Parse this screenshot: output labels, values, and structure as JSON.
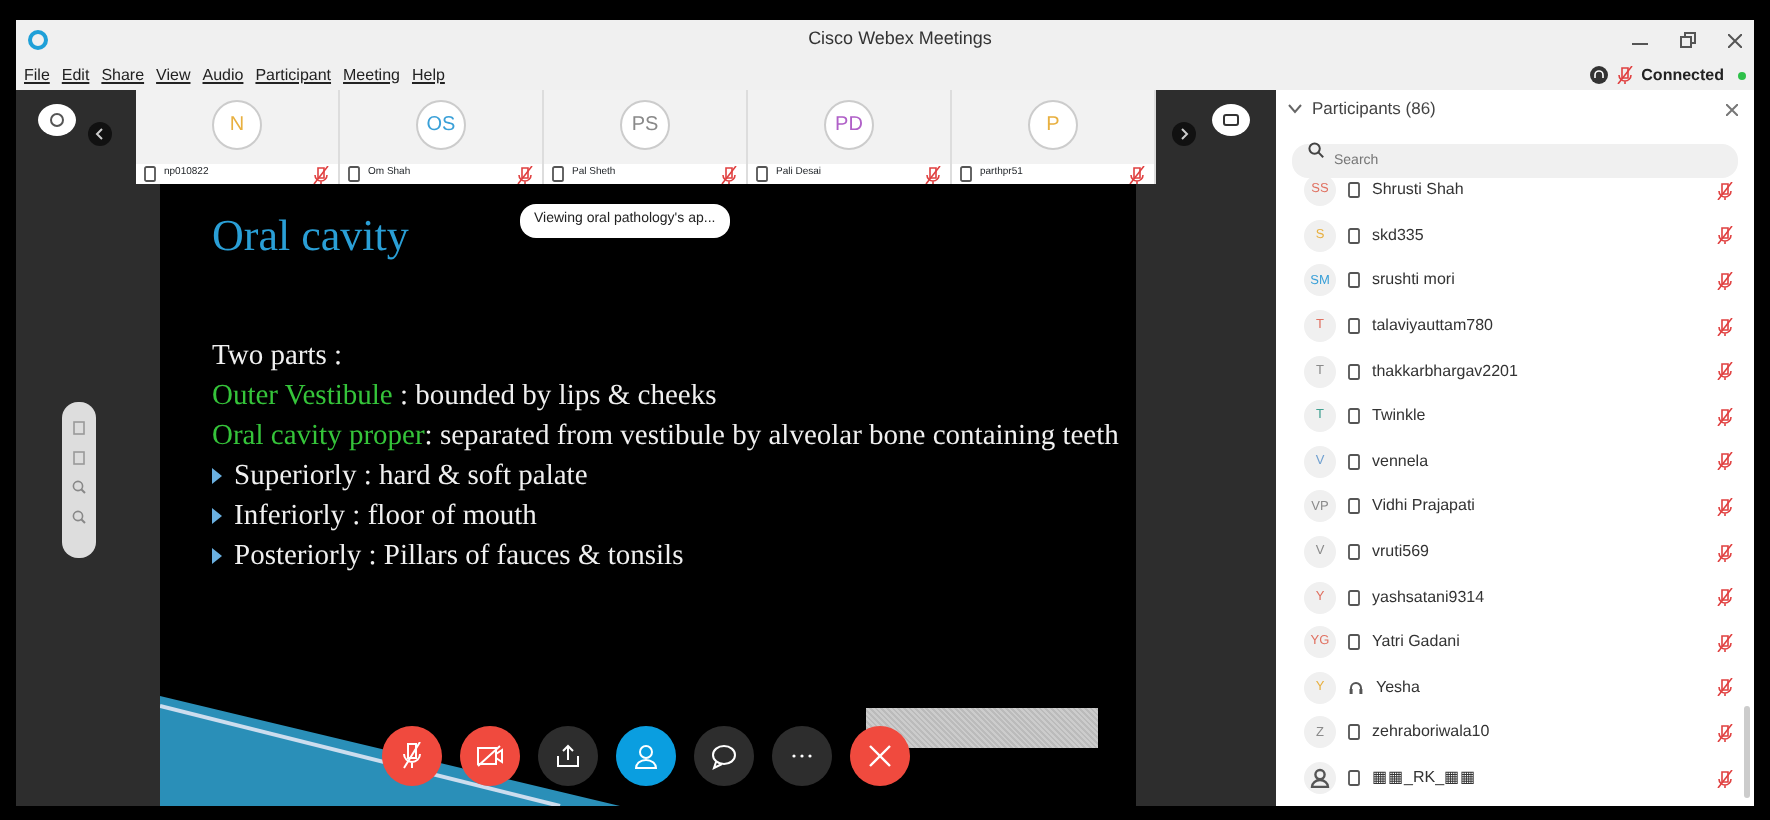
{
  "window": {
    "title": "Cisco Webex Meetings"
  },
  "menu": [
    "File",
    "Edit",
    "Share",
    "View",
    "Audio",
    "Participant",
    "Meeting",
    "Help"
  ],
  "status": {
    "text": "Connected",
    "connected": true
  },
  "thumbnails": [
    {
      "initials": "N",
      "name": "np010822",
      "color": "#e8b040"
    },
    {
      "initials": "OS",
      "name": "Om Shah",
      "color": "#3aa0d8"
    },
    {
      "initials": "PS",
      "name": "Pal Sheth",
      "color": "#8a8a8a"
    },
    {
      "initials": "PD",
      "name": "Pali Desai",
      "color": "#b060c8"
    },
    {
      "initials": "P",
      "name": "parthpr51",
      "color": "#e8b040"
    }
  ],
  "viewing_tag": "Viewing oral pathology's ap...",
  "slide": {
    "title": "Oral cavity",
    "lead": "Two parts :",
    "definitions": [
      {
        "term": "Outer Vestibule",
        "text": " : bounded by lips & cheeks"
      },
      {
        "term": "Oral cavity proper",
        "text": ": separated from vestibule by alveolar bone containing teeth"
      }
    ],
    "bullets": [
      "Superiorly : hard & soft palate",
      "Inferiorly : floor of  mouth",
      "Posteriorly  : Pillars of fauces & tonsils"
    ]
  },
  "controls": [
    {
      "kind": "mute",
      "active": false
    },
    {
      "kind": "video",
      "active": false
    },
    {
      "kind": "share",
      "active": false
    },
    {
      "kind": "participants",
      "active": true
    },
    {
      "kind": "chat",
      "active": false
    },
    {
      "kind": "more",
      "active": false
    },
    {
      "kind": "end",
      "active": false
    }
  ],
  "participants": {
    "title": "Participants (86)",
    "search": {
      "placeholder": "Search"
    },
    "items": [
      {
        "initials": "SS",
        "name": "Shrusti Shah",
        "kind": "phone",
        "color": "#e07060"
      },
      {
        "initials": "S",
        "name": "skd335",
        "kind": "phone",
        "color": "#e8b040"
      },
      {
        "initials": "SM",
        "name": "srushti mori",
        "kind": "phone",
        "color": "#3aa0d8"
      },
      {
        "initials": "T",
        "name": "talaviyauttam780",
        "kind": "phone",
        "color": "#e07060"
      },
      {
        "initials": "T",
        "name": "thakkarbhargav2201",
        "kind": "phone",
        "color": "#8a8a8a"
      },
      {
        "initials": "T",
        "name": "Twinkle",
        "kind": "phone",
        "color": "#40a090"
      },
      {
        "initials": "V",
        "name": "vennela",
        "kind": "phone",
        "color": "#70a0d0"
      },
      {
        "initials": "VP",
        "name": "Vidhi Prajapati",
        "kind": "phone",
        "color": "#8a8a8a"
      },
      {
        "initials": "V",
        "name": "vruti569",
        "kind": "phone",
        "color": "#8a8a8a"
      },
      {
        "initials": "Y",
        "name": "yashsatani9314",
        "kind": "phone",
        "color": "#e07060"
      },
      {
        "initials": "YG",
        "name": "Yatri Gadani",
        "kind": "phone",
        "color": "#e07060"
      },
      {
        "initials": "Y",
        "name": "Yesha",
        "kind": "headset",
        "color": "#e8b040"
      },
      {
        "initials": "Z",
        "name": "zehraboriwala10",
        "kind": "phone",
        "color": "#8a8a8a"
      },
      {
        "name": "▦▦_RK_▦▦",
        "kind": "phone",
        "color": "#555555"
      }
    ]
  }
}
